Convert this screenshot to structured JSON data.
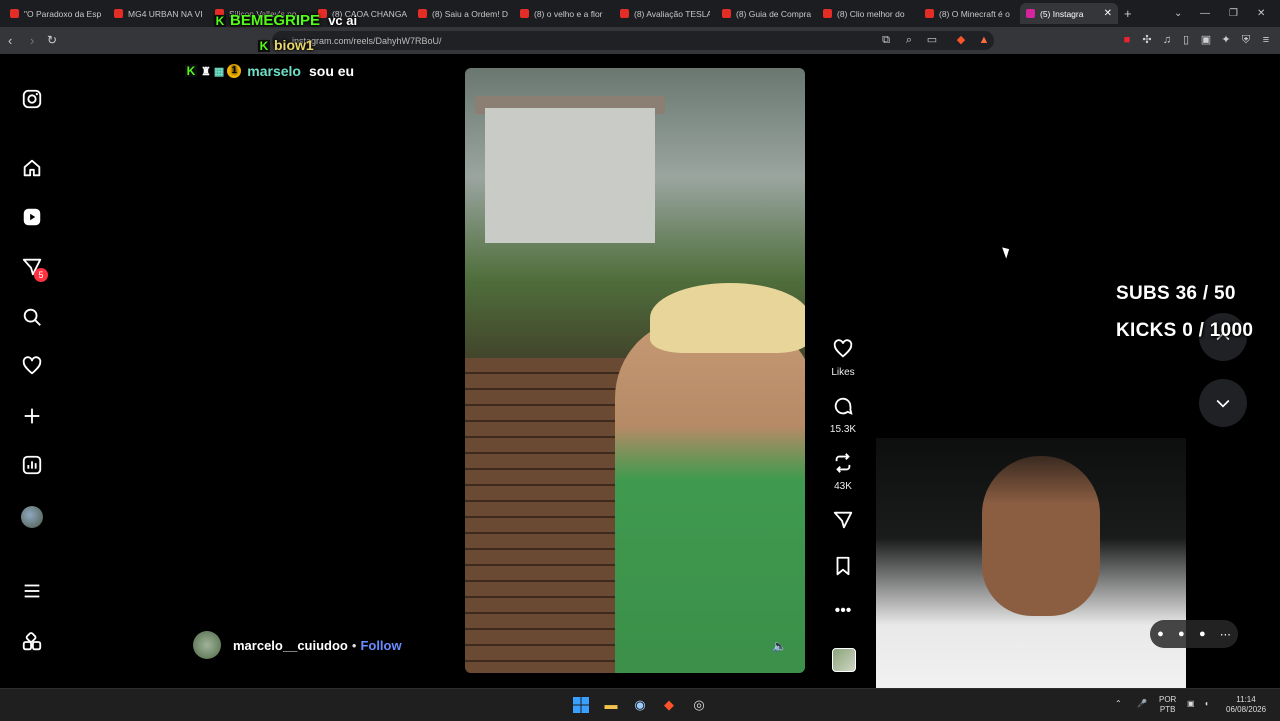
{
  "browser": {
    "tabs": [
      {
        "label": "\"O Paradoxo da Esp",
        "active": false
      },
      {
        "label": "MG4 URBAN NA VI",
        "active": false
      },
      {
        "label": "Silicon Valley's po",
        "active": false
      },
      {
        "label": "(8) CAOA CHANGA",
        "active": false
      },
      {
        "label": "(8) Saiu a Ordem! D",
        "active": false
      },
      {
        "label": "(8) o velho e a flor",
        "active": false
      },
      {
        "label": "(8) Avaliação TESLA",
        "active": false
      },
      {
        "label": "(8) Guia de Compra",
        "active": false
      },
      {
        "label": "(8) Clio melhor do",
        "active": false
      },
      {
        "label": "(8) O Minecraft é o",
        "active": false
      },
      {
        "label": "(5) Instagra",
        "active": true
      }
    ],
    "url": "instagram.com/reels/DahyhW7RBoU/",
    "new_tab_symbol": "+"
  },
  "chat_overlay": [
    {
      "user": "BEMEGRIPE",
      "message": "vc ai",
      "user_color": "#53fc18"
    },
    {
      "user": "biow1",
      "message": "",
      "user_color": "#e8d66a"
    },
    {
      "user": "marselo",
      "message": "sou eu",
      "user_color": "#6fe0c7",
      "badge_number": "1"
    }
  ],
  "sidebar": {
    "notification_count": "5",
    "icons": [
      "instagram-icon",
      "home-icon",
      "reels-icon",
      "messages-icon",
      "search-icon",
      "heart-icon",
      "create-icon",
      "dashboard-icon",
      "profile-avatar",
      "menu-icon",
      "apps-icon"
    ]
  },
  "reel": {
    "author": "marcelo__cuiudoo",
    "separator": "•",
    "follow_label": "Follow",
    "mute_symbol": "🔈"
  },
  "actions": {
    "likes_label": "Likes",
    "comments_count": "15.3K",
    "reposts_count": "43K"
  },
  "stream_stats": {
    "subs": "SUBS 36 / 50",
    "kicks": "KICKS 0 / 1000"
  },
  "taskbar": {
    "language": "POR",
    "layout": "PTB",
    "time": "11:14",
    "date": "06/08/2026"
  },
  "colors": {
    "follow": "#6a8dff",
    "badge": "#ff3040",
    "kick_green": "#53fc18"
  }
}
